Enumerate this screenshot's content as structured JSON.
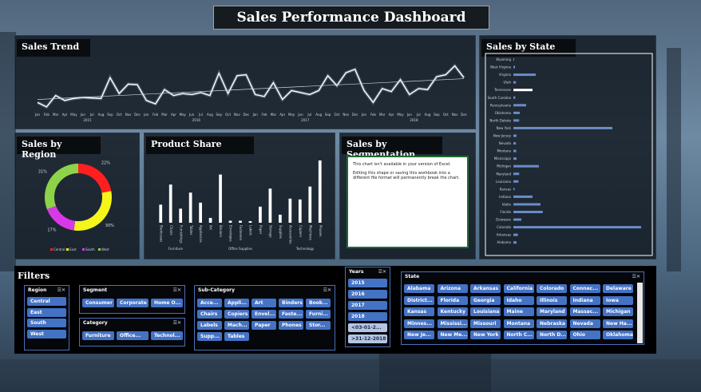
{
  "title": "Sales Performance Dashboard",
  "panels": {
    "trend": "Sales Trend",
    "region": "Sales by Region",
    "product": "Product Share",
    "segment": "Sales by Segmentation",
    "state": "Sales by State"
  },
  "segment_msg": {
    "line1": "This chart isn't available in your version of Excel.",
    "line2": "Editing this shape or saving this workbook into a different file format will permanently break the chart."
  },
  "filters": {
    "title": "Filters",
    "region": {
      "label": "Region",
      "items": [
        "Central",
        "East",
        "South",
        "West"
      ]
    },
    "segment": {
      "label": "Segment",
      "items": [
        "Consumer",
        "Corporate",
        "Home O..."
      ]
    },
    "category": {
      "label": "Category",
      "items": [
        "Furniture",
        "Office...",
        "Technol..."
      ]
    },
    "subcategory": {
      "label": "Sub-Category",
      "items": [
        "Acce...",
        "Appli...",
        "Art",
        "Binders",
        "Book...",
        "Chairs",
        "Copiers",
        "Envel...",
        "Faste...",
        "Furni...",
        "Labels",
        "Mach...",
        "Paper",
        "Phones",
        "Stor...",
        "Supp...",
        "Tables"
      ]
    },
    "years": {
      "label": "Years",
      "items": [
        "2015",
        "2016",
        "2017",
        "2018",
        "<03-01-2...",
        ">31-12-2018"
      ]
    },
    "state": {
      "label": "State",
      "items": [
        "Alabama",
        "Arizona",
        "Arkansas",
        "California",
        "Colorado",
        "Connec...",
        "Delaware",
        "District...",
        "Florida",
        "Georgia",
        "Idaho",
        "Illinois",
        "Indiana",
        "Iowa",
        "Kansas",
        "Kentucky",
        "Louisiana",
        "Maine",
        "Maryland",
        "Massac...",
        "Michigan",
        "Minnes...",
        "Mississi...",
        "Missouri",
        "Montana",
        "Nebraska",
        "Nevada",
        "New Ha...",
        "New Je...",
        "New Me...",
        "New York",
        "North C...",
        "North D...",
        "Ohio",
        "Oklahoma"
      ]
    }
  },
  "chart_data": [
    {
      "type": "line",
      "title": "Sales Trend",
      "x": [
        "Jan",
        "Feb",
        "Mar",
        "Apr",
        "May",
        "Jun",
        "Jul",
        "Aug",
        "Sep",
        "Oct",
        "Nov",
        "Dec",
        "Jan",
        "Feb",
        "Mar",
        "Apr",
        "May",
        "Jun",
        "Jul",
        "Aug",
        "Sep",
        "Oct",
        "Nov",
        "Dec",
        "Jan",
        "Feb",
        "Mar",
        "Apr",
        "May",
        "Jun",
        "Jul",
        "Aug",
        "Sep",
        "Oct",
        "Nov",
        "Dec",
        "Jan",
        "Feb",
        "Mar",
        "Apr",
        "May",
        "Jun",
        "Jul",
        "Aug",
        "Sep",
        "Oct",
        "Nov",
        "Dec"
      ],
      "year_labels": [
        "2015",
        "2016",
        "2017",
        "2018"
      ],
      "values": [
        14,
        5,
        28,
        18,
        22,
        24,
        23,
        22,
        64,
        32,
        51,
        50,
        18,
        11,
        40,
        28,
        32,
        30,
        34,
        28,
        73,
        32,
        68,
        70,
        30,
        26,
        54,
        20,
        38,
        34,
        30,
        38,
        68,
        48,
        74,
        81,
        38,
        14,
        42,
        36,
        60,
        30,
        42,
        40,
        66,
        70,
        88,
        64
      ],
      "trendline": [
        20,
        62
      ],
      "ylim": [
        0,
        100
      ]
    },
    {
      "type": "pie",
      "title": "Sales by Region",
      "labels": [
        "Central",
        "East",
        "South",
        "West"
      ],
      "values": [
        22,
        30,
        17,
        31
      ],
      "data_labels": [
        "22%",
        "30%",
        "17%",
        "31%"
      ],
      "colors": [
        "#ff1f1f",
        "#f5f51a",
        "#d838e6",
        "#8ed24a"
      ]
    },
    {
      "type": "bar",
      "title": "Product Share",
      "categories": [
        "Bookcases",
        "Chairs",
        "Furnishings",
        "Tables",
        "Appliances",
        "Art",
        "Binders",
        "Envelopes",
        "Fasteners",
        "Labels",
        "Paper",
        "Storage",
        "Supplies",
        "Accessories",
        "Copiers",
        "Machines",
        "Phones"
      ],
      "groups": [
        {
          "name": "Furniture",
          "count": 4
        },
        {
          "name": "Office Supplies",
          "count": 9
        },
        {
          "name": "Technology",
          "count": 4
        }
      ],
      "values": [
        45,
        95,
        35,
        75,
        50,
        12,
        120,
        5,
        5,
        4,
        40,
        85,
        20,
        60,
        58,
        90,
        155
      ]
    },
    {
      "type": "bar",
      "orientation": "horizontal",
      "title": "Sales by State",
      "categories": [
        "Wyoming",
        "West Virginia",
        "Virginia",
        "Utah",
        "Tennessee",
        "South Carolina",
        "Pennsylvania",
        "Oklahoma",
        "North Dakota",
        "New York",
        "New Jersey",
        "Nevada",
        "Montana",
        "Mississippi",
        "Michigan",
        "Maryland",
        "Louisiana",
        "Kansas",
        "Indiana",
        "Idaho",
        "Florida",
        "Delaware",
        "Colorado",
        "Arkansas",
        "Alabama"
      ],
      "values": [
        2,
        5,
        70,
        8,
        60,
        6,
        40,
        20,
        18,
        310,
        10,
        8,
        9,
        10,
        80,
        18,
        16,
        4,
        60,
        85,
        92,
        25,
        400,
        14,
        10
      ],
      "xlim": [
        0,
        420
      ]
    }
  ]
}
